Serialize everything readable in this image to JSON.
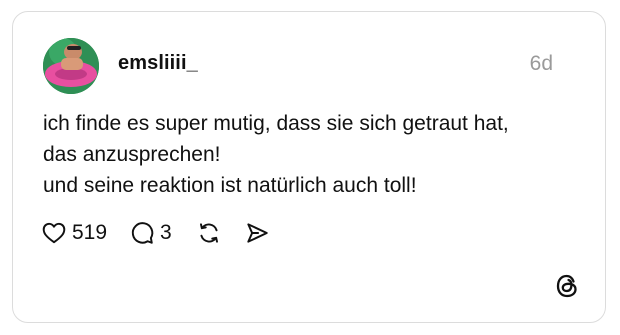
{
  "post": {
    "username": "emsliiii_",
    "timestamp": "6d",
    "text_lines": [
      "ich finde es super mutig, dass sie sich getraut hat,",
      "das anzusprechen!",
      "und seine reaktion ist natürlich auch toll!"
    ],
    "likes": "519",
    "replies": "3"
  },
  "icons": {
    "like": "heart-icon",
    "reply": "speech-bubble-icon",
    "repost": "repost-icon",
    "share": "send-icon",
    "brand": "threads-logo-icon"
  }
}
